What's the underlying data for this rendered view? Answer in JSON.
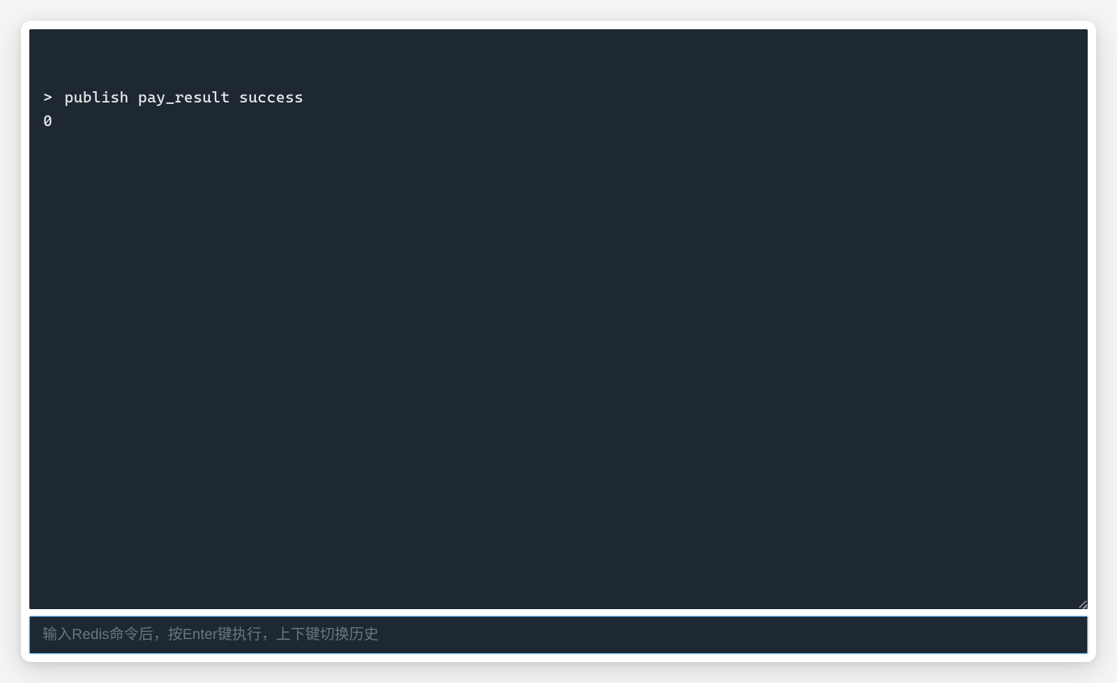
{
  "terminal": {
    "prompt": ">",
    "command": "publish pay_result success",
    "result": "0",
    "input_value": "",
    "input_placeholder": "输入Redis命令后，按Enter键执行，上下键切换历史"
  },
  "colors": {
    "terminal_bg": "#1e2833",
    "terminal_fg": "#e8e8e8",
    "focus_border": "#4a9fd8",
    "placeholder": "#6b7580"
  }
}
